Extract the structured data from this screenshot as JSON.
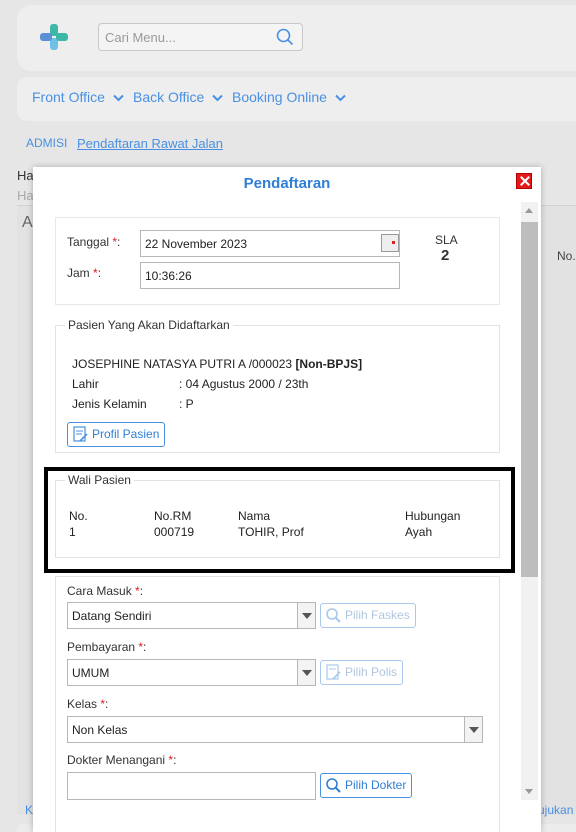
{
  "search": {
    "placeholder": "Cari Menu..."
  },
  "nav": {
    "items": [
      "Front Office",
      "Back Office",
      "Booking Online"
    ]
  },
  "breadcrumb": {
    "section": "ADMISI",
    "page": "Pendaftaran Rawat Jalan"
  },
  "background": {
    "ha1": "Ha",
    "ha2": "Ha",
    "a": "A",
    "no": "No.",
    "k": "K",
    "tujukan": "ujukan"
  },
  "modal": {
    "title": "Pendaftaran",
    "tanggal_label": "Tanggal ",
    "tanggal_value": "22 November 2023",
    "jam_label": "Jam ",
    "jam_value": "10:36:26",
    "sla_label": "SLA",
    "sla_value": "2",
    "required_mark": "*",
    "colon": ":",
    "pasien": {
      "legend": "Pasien Yang Akan Didaftarkan",
      "name_line": "JOSEPHINE NATASYA PUTRI A /000023 ",
      "status": "[Non-BPJS]",
      "lahir_label": "Lahir",
      "lahir_value": ": 04 Agustus 2000 / 23th",
      "jk_label": "Jenis Kelamin",
      "jk_value": ": P",
      "profil_button": "Profil Pasien"
    },
    "wali": {
      "legend": "Wali Pasien",
      "headers": [
        "No.",
        "No.RM",
        "Nama",
        "Hubungan"
      ],
      "rows": [
        [
          "1",
          "000719",
          "TOHIR, Prof",
          "Ayah"
        ]
      ]
    },
    "cara_masuk_label": "Cara Masuk ",
    "cara_masuk_value": "Datang Sendiri",
    "pilih_faskes": "Pilih Faskes",
    "pembayaran_label": "Pembayaran ",
    "pembayaran_value": "UMUM",
    "pilih_polis": "Pilih Polis",
    "kelas_label": "Kelas ",
    "kelas_value": "Non Kelas",
    "dokter_label": "Dokter Menangani ",
    "dokter_value": "",
    "pilih_dokter": "Pilih Dokter"
  },
  "colors": {
    "accent": "#4a90e2",
    "title": "#2f7fd6",
    "close": "#e21a1a",
    "required": "#e21a1a"
  }
}
